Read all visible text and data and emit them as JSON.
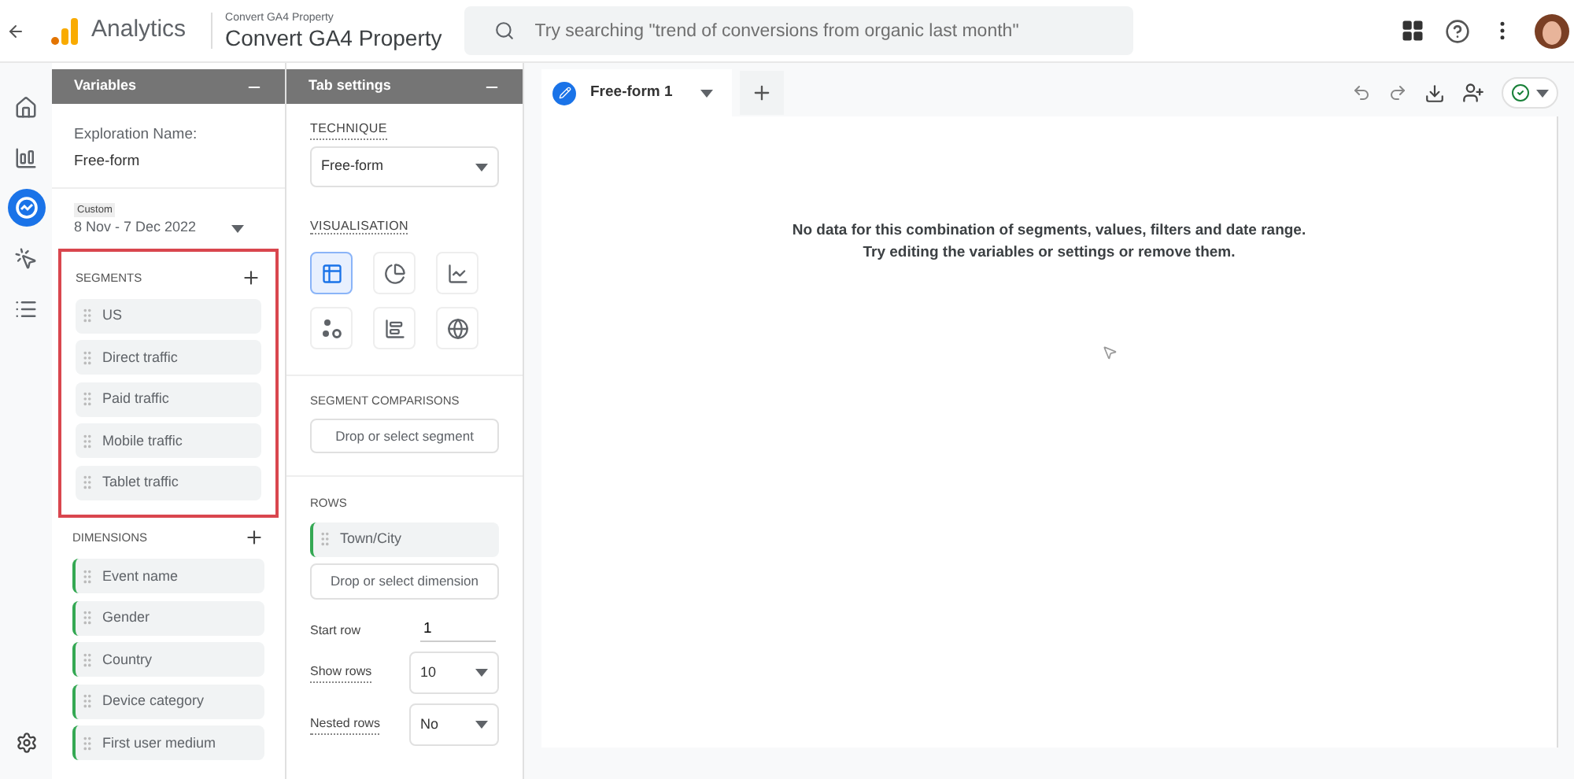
{
  "header": {
    "app_name": "Analytics",
    "property_label": "Convert GA4 Property",
    "property_name": "Convert GA4 Property",
    "search": {
      "placeholder": "Try searching \"trend of conversions from organic last month\""
    }
  },
  "nav": [
    {
      "kind": "home",
      "selected": false
    },
    {
      "kind": "reports",
      "selected": false
    },
    {
      "kind": "explore",
      "selected": true
    },
    {
      "kind": "advertising",
      "selected": false
    },
    {
      "kind": "configure",
      "selected": false
    }
  ],
  "variables": {
    "title": "Variables",
    "exploration_name_label": "Exploration Name:",
    "exploration_name": "Free-form",
    "date_label": "Custom",
    "date_range": "8 Nov - 7 Dec 2022",
    "segments": {
      "heading": "SEGMENTS",
      "highlighted": true,
      "items": [
        "US",
        "Direct traffic",
        "Paid traffic",
        "Mobile traffic",
        "Tablet traffic"
      ]
    },
    "dimensions": {
      "heading": "DIMENSIONS",
      "items": [
        "Event name",
        "Gender",
        "Country",
        "Device category",
        "First user medium"
      ]
    }
  },
  "tab_settings": {
    "title": "Tab settings",
    "technique_label": "TECHNIQUE",
    "technique": "Free-form",
    "visualisation_label": "VISUALISATION",
    "visualisations": [
      {
        "kind": "table",
        "selected": true
      },
      {
        "kind": "donut",
        "selected": false
      },
      {
        "kind": "line",
        "selected": false
      },
      {
        "kind": "scatter",
        "selected": false
      },
      {
        "kind": "bar",
        "selected": false
      },
      {
        "kind": "geo",
        "selected": false
      }
    ],
    "segment_comparisons_label": "SEGMENT COMPARISONS",
    "segment_drop": "Drop or select segment",
    "rows_label": "ROWS",
    "rows": [
      "Town/City"
    ],
    "dimension_drop": "Drop or select dimension",
    "start_row_label": "Start row",
    "start_row": "1",
    "show_rows_label": "Show rows",
    "show_rows": "10",
    "nested_rows_label": "Nested rows",
    "nested_rows": "No"
  },
  "canvas": {
    "tabs": [
      {
        "label": "Free-form 1",
        "selected": true
      }
    ],
    "message": [
      "No data for this combination of segments, values, filters and date range.",
      "Try editing the variables or settings or remove them."
    ]
  }
}
